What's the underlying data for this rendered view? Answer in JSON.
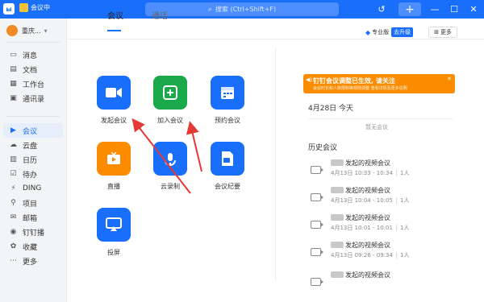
{
  "titlebar": {
    "logo": "ы",
    "status": "会议中",
    "search_placeholder": "搜索 (Ctrl+Shift+F)",
    "icons": [
      "history-icon",
      "plus-icon",
      "minimize-icon",
      "maximize-icon",
      "close-icon"
    ]
  },
  "user": {
    "name": "重庆..."
  },
  "sidebar": {
    "items": [
      {
        "label": "消息",
        "icon": "message-icon"
      },
      {
        "label": "文档",
        "icon": "document-icon"
      },
      {
        "label": "工作台",
        "icon": "workbench-icon"
      },
      {
        "label": "通讯录",
        "icon": "contacts-icon"
      },
      {
        "label": "会议",
        "icon": "meeting-icon",
        "active": true
      },
      {
        "label": "云盘",
        "icon": "cloud-icon"
      },
      {
        "label": "日历",
        "icon": "calendar-icon"
      },
      {
        "label": "待办",
        "icon": "todo-icon"
      },
      {
        "label": "DING",
        "icon": "ding-icon"
      },
      {
        "label": "项目",
        "icon": "project-icon"
      },
      {
        "label": "邮箱",
        "icon": "mail-icon"
      },
      {
        "label": "钉钉播",
        "icon": "live-icon"
      },
      {
        "label": "收藏",
        "icon": "favorite-icon"
      },
      {
        "label": "更多",
        "icon": "more-icon"
      }
    ]
  },
  "tabs": [
    {
      "label": "会议",
      "active": true
    },
    {
      "label": "通话",
      "active": false
    }
  ],
  "header": {
    "pro_label": "专业版",
    "upgrade_label": "去升级",
    "more_label": "更多"
  },
  "apps": [
    {
      "label": "发起会议",
      "color": "#1a6ffa",
      "icon": "video-icon"
    },
    {
      "label": "加入会议",
      "color": "#19a84a",
      "icon": "join-icon"
    },
    {
      "label": "预约会议",
      "color": "#1a6ffa",
      "icon": "schedule-icon"
    },
    {
      "label": "直播",
      "color": "#fb8c00",
      "icon": "live-tv-icon"
    },
    {
      "label": "云录制",
      "color": "#1a6ffa",
      "icon": "cloud-record-icon"
    },
    {
      "label": "会议纪要",
      "color": "#1a6ffa",
      "icon": "minutes-icon"
    },
    {
      "label": "投屏",
      "color": "#1a6ffa",
      "icon": "cast-icon"
    }
  ],
  "banner": {
    "title": "钉钉会议调整已生效, 请关注",
    "subtitle": "会议时长和人数限制等规则调整 查看详情及更多说明"
  },
  "today": {
    "date": "4月28日 今天",
    "empty": "暂无会议"
  },
  "history": {
    "title": "历史会议",
    "items": [
      {
        "name": "发起的视频会议",
        "time": "4月13日 10:33 - 10:34",
        "count": "1人"
      },
      {
        "name": "发起的视频会议",
        "time": "4月13日 10:04 - 10:05",
        "count": "1人"
      },
      {
        "name": "发起的视频会议",
        "time": "4月13日 10:01 - 10:01",
        "count": "1人"
      },
      {
        "name": "发起的视频会议",
        "time": "4月13日 09:26 - 09:34",
        "count": "1人"
      },
      {
        "name": "发起的视频会议",
        "time": "",
        "count": ""
      }
    ]
  },
  "colors": {
    "accent": "#1a6ffa",
    "banner": "#fb8c00",
    "green": "#19a84a",
    "arrow": "#e53935"
  }
}
